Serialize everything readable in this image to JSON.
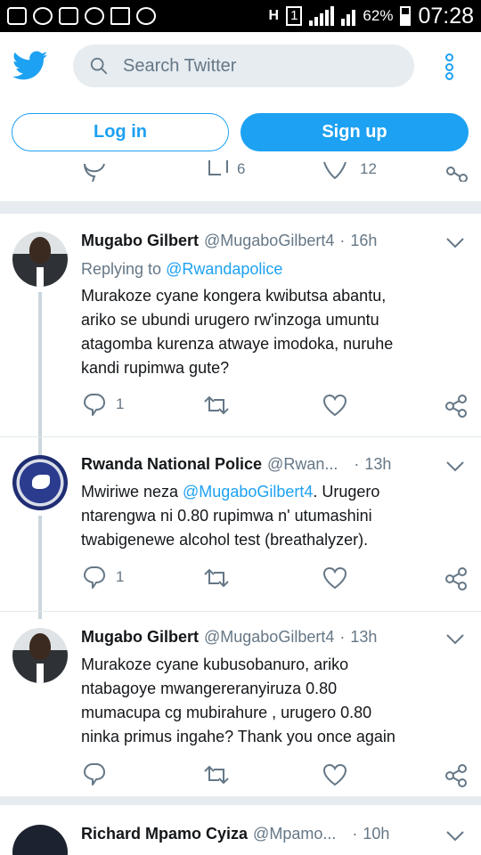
{
  "status_bar": {
    "battery": "62%",
    "time": "07:28",
    "network_h": "H",
    "sim_badge": "1"
  },
  "header": {
    "search_placeholder": "Search Twitter"
  },
  "auth": {
    "login_label": "Log in",
    "signup_label": "Sign up"
  },
  "previous_tweet_actions": {
    "retweets": "6",
    "likes": "12"
  },
  "tweets": [
    {
      "name": "Mugabo Gilbert",
      "handle": "@MugaboGilbert4",
      "dot": "·",
      "time": "16h",
      "replying_prefix": "Replying to ",
      "replying_to": "@Rwandapolice",
      "lines": [
        "Murakoze cyane kongera kwibutsa abantu,",
        "ariko se ubundi urugero rw'inzoga umuntu",
        "atagomba kurenza atwaye imodoka, nuruhe",
        "kandi rupimwa gute?"
      ],
      "replies": "1"
    },
    {
      "name": "Rwanda National Police",
      "handle": "@Rwan...",
      "dot": "·",
      "time": "13h",
      "line1_prefix": "Mwiriwe neza ",
      "line1_mention": "@MugaboGilbert4",
      "line1_suffix": ". Urugero",
      "lines": [
        "ntarengwa ni 0.80 rupimwa n' utumashini",
        "twabigenewe alcohol test (breathalyzer)."
      ],
      "replies": "1"
    },
    {
      "name": "Mugabo Gilbert",
      "handle": "@MugaboGilbert4",
      "dot": "·",
      "time": "13h",
      "lines": [
        "Murakoze cyane kubusobanuro, ariko",
        "ntabagoye mwangereranyiruza 0.80",
        "mumacupa cg mubirahure , urugero 0.80",
        "ninka primus ingahe? Thank you once again"
      ]
    },
    {
      "name": "Richard Mpamo Cyiza",
      "handle": "@Mpamo...",
      "dot": "·",
      "time": "10h"
    }
  ]
}
